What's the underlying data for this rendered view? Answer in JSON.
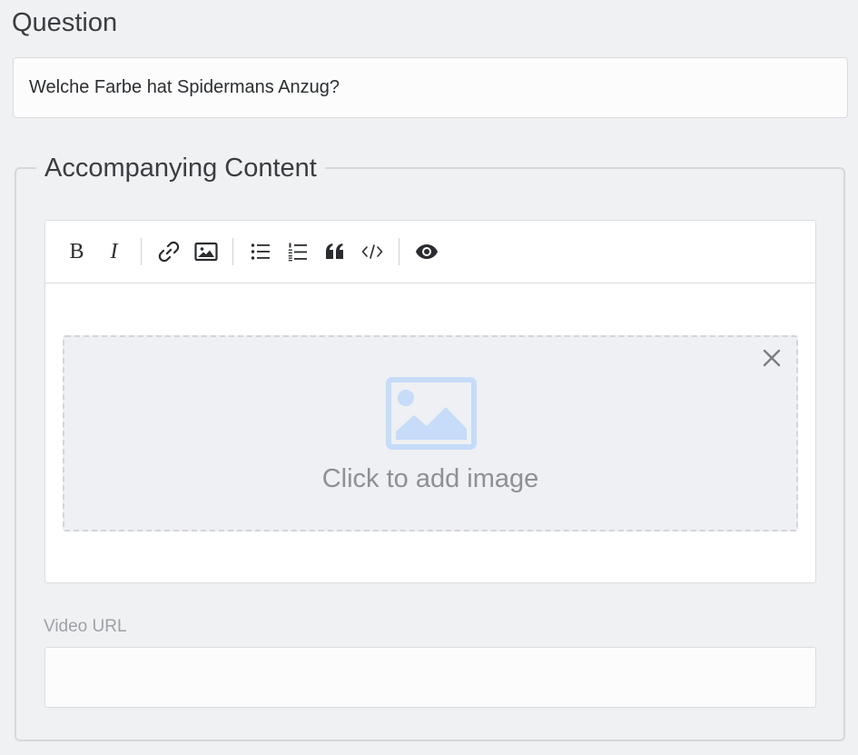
{
  "question": {
    "label": "Question",
    "value": "Welche Farbe hat Spidermans Anzug?"
  },
  "accompanying": {
    "legend": "Accompanying Content",
    "toolbar": {
      "bold_label": "B",
      "italic_label": "I",
      "icons": [
        "bold-icon",
        "italic-icon",
        "link-icon",
        "image-icon",
        "bullet-list-icon",
        "numbered-list-icon",
        "quote-icon",
        "code-icon",
        "preview-eye-icon"
      ]
    },
    "image_placeholder": {
      "caption": "Click to add image",
      "icon": "image-placeholder-icon",
      "icon_color": "#c9ddf7"
    },
    "video": {
      "label": "Video URL",
      "value": "",
      "placeholder": ""
    }
  }
}
